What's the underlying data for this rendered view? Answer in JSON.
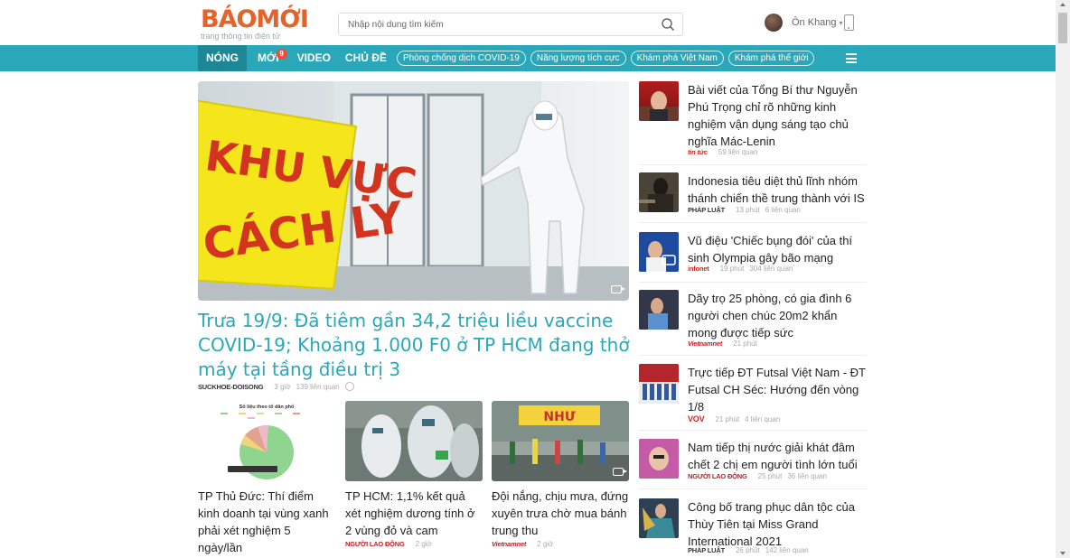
{
  "header": {
    "logo_text": "BÁOMỚI",
    "logo_tagline": "trang thông tin điện tử",
    "search_placeholder": "Nhập nội dung tìm kiếm",
    "user_name": "Ôn Khang"
  },
  "nav": {
    "items": [
      "NÓNG",
      "MỚI",
      "VIDEO",
      "CHỦ ĐỀ"
    ],
    "new_badge": "9",
    "pills": [
      "Phòng chống dịch COVID-19",
      "Năng lượng tích cực",
      "Khám phá Việt Nam",
      "Khám phá thế giới"
    ]
  },
  "hero": {
    "image_sign": "KHU VỰC CÁCH LY",
    "title": "Trưa 19/9: Đã tiêm gần 34,2 triệu liều vaccine COVID-19; Khoảng 1.000 F0 ở TP HCM đang thở máy tại tầng điều trị 3",
    "source": "SUCKHOE-DOISONG",
    "time": "3 giờ",
    "related": "139 liên quan"
  },
  "cards": [
    {
      "title": "TP Thủ Đức: Thí điểm kinh doanh tại vùng xanh phải xét nghiệm 5 ngày/lần",
      "chart_caption": "Số liệu theo tổ dân phố"
    },
    {
      "title": "TP HCM: 1,1% kết quả xét nghiệm dương tính ở 2 vùng đỏ và cam",
      "source": "NGƯỜI LAO ĐỘNG",
      "time": "2 giờ"
    },
    {
      "title": "Đội nắng, chịu mưa, đứng xuyên trưa chờ mua bánh trung thu",
      "source": "Vietnamnet",
      "time": "2 giờ"
    }
  ],
  "sidebar": [
    {
      "title": "Bài viết của Tổng Bí thư Nguyễn Phú Trọng chỉ rõ những kinh nghiệm vận dụng sáng tạo chủ nghĩa Mác-Lenin",
      "source": "tin tức",
      "time": "",
      "related": "59 liên quan"
    },
    {
      "title": "Indonesia tiêu diệt thủ lĩnh nhóm thánh chiến thề trung thành với IS",
      "source": "PHÁP LUẬT",
      "time": "13 phút",
      "related": "6 liên quan"
    },
    {
      "title": "Vũ điệu 'Chiếc bụng đói' của thí sinh Olympia gây bão mạng",
      "source": "infonet",
      "time": "19 phút",
      "related": "304 liên quan"
    },
    {
      "title": "Dãy trọ 25 phòng, có gia đình 6 người chen chúc 20m2 khẩn mong được tiếp sức",
      "source": "Vietnamnet",
      "time": "21 phút",
      "related": ""
    },
    {
      "title": "Trực tiếp ĐT Futsal Việt Nam - ĐT Futsal CH Séc: Hướng đến vòng 1/8",
      "source": "VOV",
      "time": "21 phút",
      "related": "4 liên quan"
    },
    {
      "title": "Nam tiếp thị nước giải khát đâm chết 2 chị em người tình lớn tuổi",
      "source": "NGƯỜI LAO ĐỘNG",
      "time": "25 phút",
      "related": "36 liên quan"
    },
    {
      "title": "Công bố trang phục dân tộc của Thùy Tiên tại Miss Grand International 2021",
      "source": "PHÁP LUẬT",
      "time": "26 phút",
      "related": "142 liên quan"
    }
  ],
  "colors": {
    "brand": "#e7612a",
    "accent": "#2aa7b8",
    "badge": "#ef4b3a"
  }
}
